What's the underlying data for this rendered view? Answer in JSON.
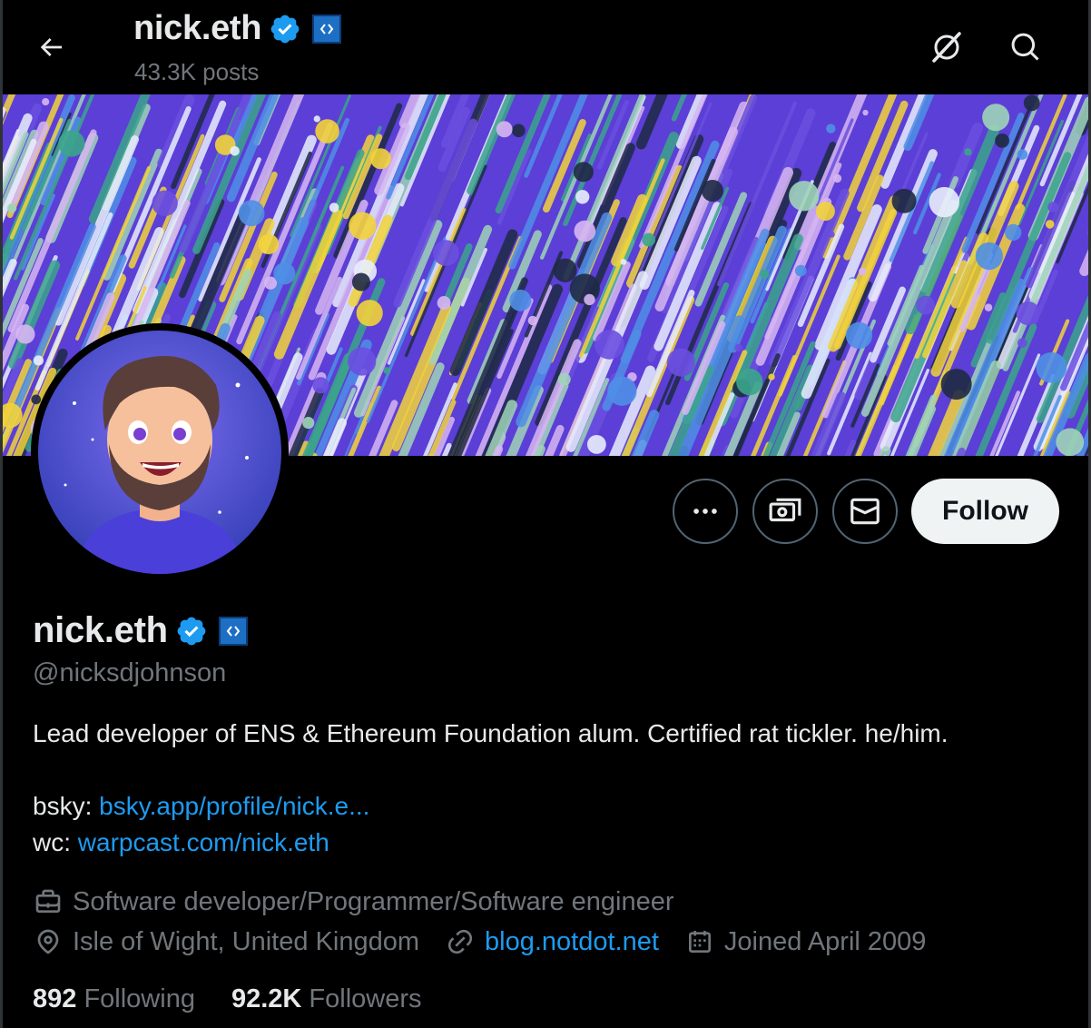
{
  "header": {
    "name": "nick.eth",
    "posts_count": "43.3K posts"
  },
  "profile": {
    "display_name": "nick.eth",
    "handle": "@nicksdjohnson",
    "bio_line": "Lead developer of ENS & Ethereum Foundation alum. Certified rat tickler. he/him.",
    "bsky_prefix": "bsky:",
    "bsky_link": "bsky.app/profile/nick.e...",
    "wc_prefix": "wc:",
    "wc_link": "warpcast.com/nick.eth",
    "profession": "Software developer/Programmer/Software engineer",
    "location": "Isle of Wight, United Kingdom",
    "website": "blog.notdot.net",
    "joined": "Joined April 2009"
  },
  "actions": {
    "follow_label": "Follow"
  },
  "stats": {
    "following_count": "892",
    "following_label": "Following",
    "followers_count": "92.2K",
    "followers_label": "Followers"
  },
  "colors": {
    "background": "#000000",
    "primary_text": "#e7e9ea",
    "secondary_text": "#71767b",
    "link": "#1d9bf0",
    "verified": "#1d9bf0",
    "follow_button_bg": "#eff3f4"
  },
  "icons": {
    "back": "arrow-left-icon",
    "grok": "grok-icon",
    "search": "search-icon",
    "more": "more-icon",
    "subscribe": "money-icon",
    "message": "envelope-icon",
    "profession": "briefcase-icon",
    "location": "location-pin-icon",
    "website": "link-icon",
    "joined": "calendar-icon",
    "verified": "verified-badge-icon",
    "affiliate": "affiliate-badge-icon"
  }
}
